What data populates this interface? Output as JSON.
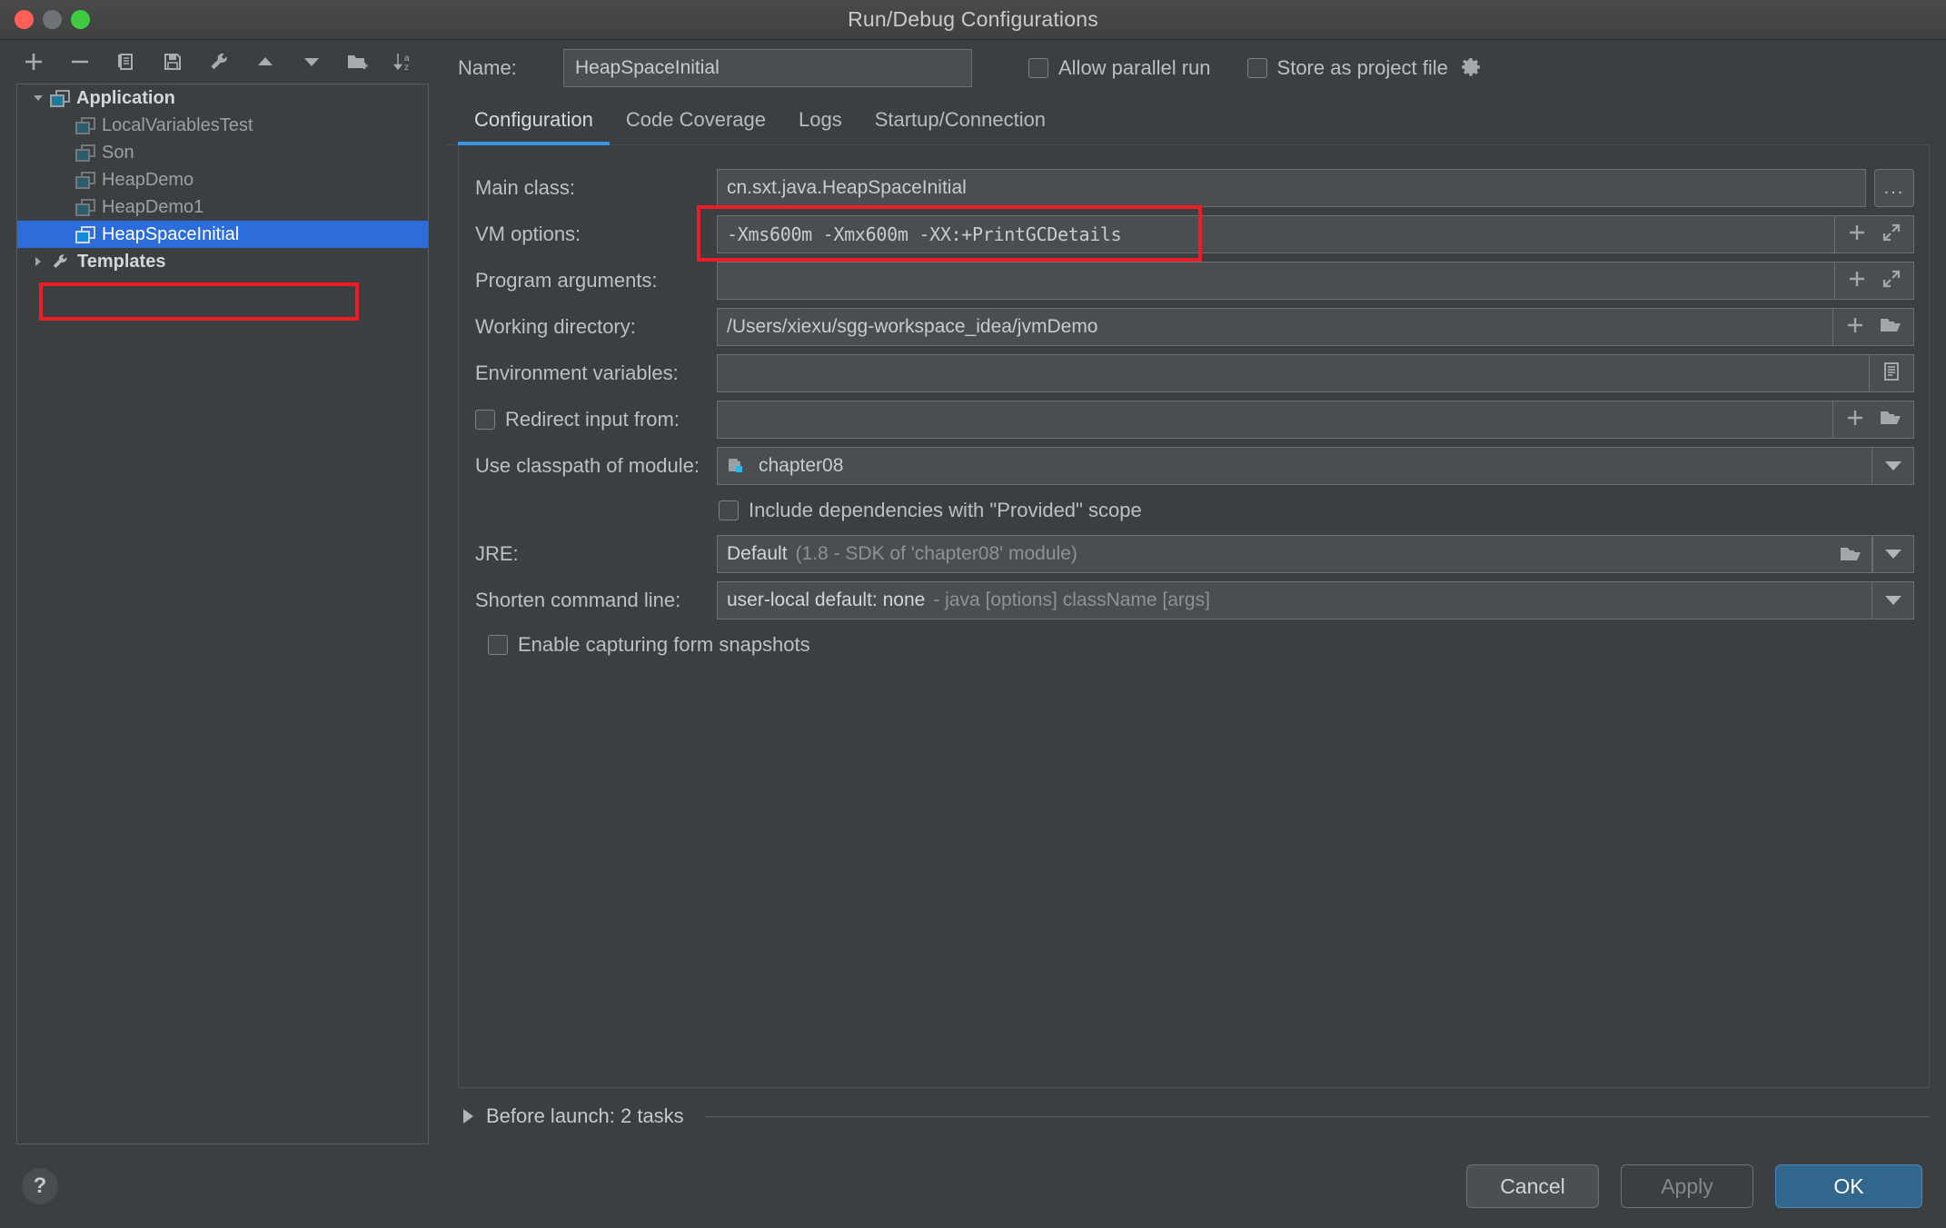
{
  "window": {
    "title": "Run/Debug Configurations",
    "traffic_lights": [
      "close-button",
      "minimize-button",
      "maximize-button"
    ]
  },
  "toolbar": {
    "buttons": [
      {
        "name": "add-configuration-button",
        "icon": "plus-icon"
      },
      {
        "name": "remove-configuration-button",
        "icon": "minus-icon"
      },
      {
        "name": "copy-configuration-button",
        "icon": "copy-icon"
      },
      {
        "name": "save-configuration-button",
        "icon": "save-icon"
      },
      {
        "name": "edit-templates-button",
        "icon": "wrench-icon"
      },
      {
        "name": "move-up-button",
        "icon": "arrow-up-icon"
      },
      {
        "name": "move-down-button",
        "icon": "arrow-down-icon"
      },
      {
        "name": "new-folder-button",
        "icon": "folder-add-icon"
      },
      {
        "name": "sort-configurations-button",
        "icon": "sort-az-icon"
      }
    ]
  },
  "tree": {
    "root": {
      "label": "Application",
      "icon": "application-icon",
      "expanded": true
    },
    "children": [
      {
        "label": "LocalVariablesTest",
        "icon": "application-icon",
        "selected": false
      },
      {
        "label": "Son",
        "icon": "application-icon",
        "selected": false
      },
      {
        "label": "HeapDemo",
        "icon": "application-icon",
        "selected": false
      },
      {
        "label": "HeapDemo1",
        "icon": "application-icon",
        "selected": false
      },
      {
        "label": "HeapSpaceInitial",
        "icon": "application-icon",
        "selected": true
      }
    ],
    "templates": {
      "label": "Templates",
      "icon": "wrench-icon",
      "expanded": false
    }
  },
  "header": {
    "name_label": "Name:",
    "name_value": "HeapSpaceInitial",
    "allow_parallel_run": "Allow parallel run",
    "allow_parallel_run_checked": false,
    "store_as_project_file": "Store as project file",
    "store_as_project_file_checked": false,
    "gear_icon": "gear-icon"
  },
  "tabs": [
    {
      "label": "Configuration",
      "active": true
    },
    {
      "label": "Code Coverage",
      "active": false
    },
    {
      "label": "Logs",
      "active": false
    },
    {
      "label": "Startup/Connection",
      "active": false
    }
  ],
  "form": {
    "main_class": {
      "label": "Main class:",
      "value": "cn.sxt.java.HeapSpaceInitial",
      "browse_label": "..."
    },
    "vm_options": {
      "label": "VM options:",
      "value": "-Xms600m -Xmx600m -XX:+PrintGCDetails",
      "icons": [
        "plus-icon",
        "expand-icon"
      ]
    },
    "program_arguments": {
      "label": "Program arguments:",
      "value": "",
      "icons": [
        "plus-icon",
        "expand-icon"
      ]
    },
    "working_directory": {
      "label": "Working directory:",
      "value": "/Users/xiexu/sgg-workspace_idea/jvmDemo",
      "icons": [
        "plus-icon",
        "folder-icon"
      ]
    },
    "environment_variables": {
      "label": "Environment variables:",
      "value": "",
      "icons": [
        "list-icon"
      ]
    },
    "redirect_input": {
      "label": "Redirect input from:",
      "checked": false,
      "value": "",
      "icons": [
        "plus-icon",
        "folder-icon"
      ]
    },
    "classpath_module": {
      "label": "Use classpath of module:",
      "value": "chapter08",
      "icon": "module-icon"
    },
    "include_provided": {
      "label": "Include dependencies with \"Provided\" scope",
      "checked": false
    },
    "jre": {
      "label": "JRE:",
      "value_strong": "Default",
      "value_muted": "(1.8 - SDK of 'chapter08' module)",
      "icons": [
        "folder-icon",
        "chevron-down-icon"
      ]
    },
    "shorten_command_line": {
      "label": "Shorten command line:",
      "value_strong": "user-local default: none",
      "value_muted": "- java [options] className [args]",
      "icons": [
        "chevron-down-icon"
      ]
    },
    "enable_form_snapshots": {
      "label": "Enable capturing form snapshots",
      "checked": false
    }
  },
  "before_launch": {
    "label": "Before launch: 2 tasks",
    "expanded": false
  },
  "footer": {
    "help_label": "?",
    "cancel_label": "Cancel",
    "apply_label": "Apply",
    "ok_label": "OK"
  },
  "annotations": {
    "color": "#ee1c24",
    "regions": [
      "selected-tree-row",
      "vm-options-field"
    ]
  }
}
